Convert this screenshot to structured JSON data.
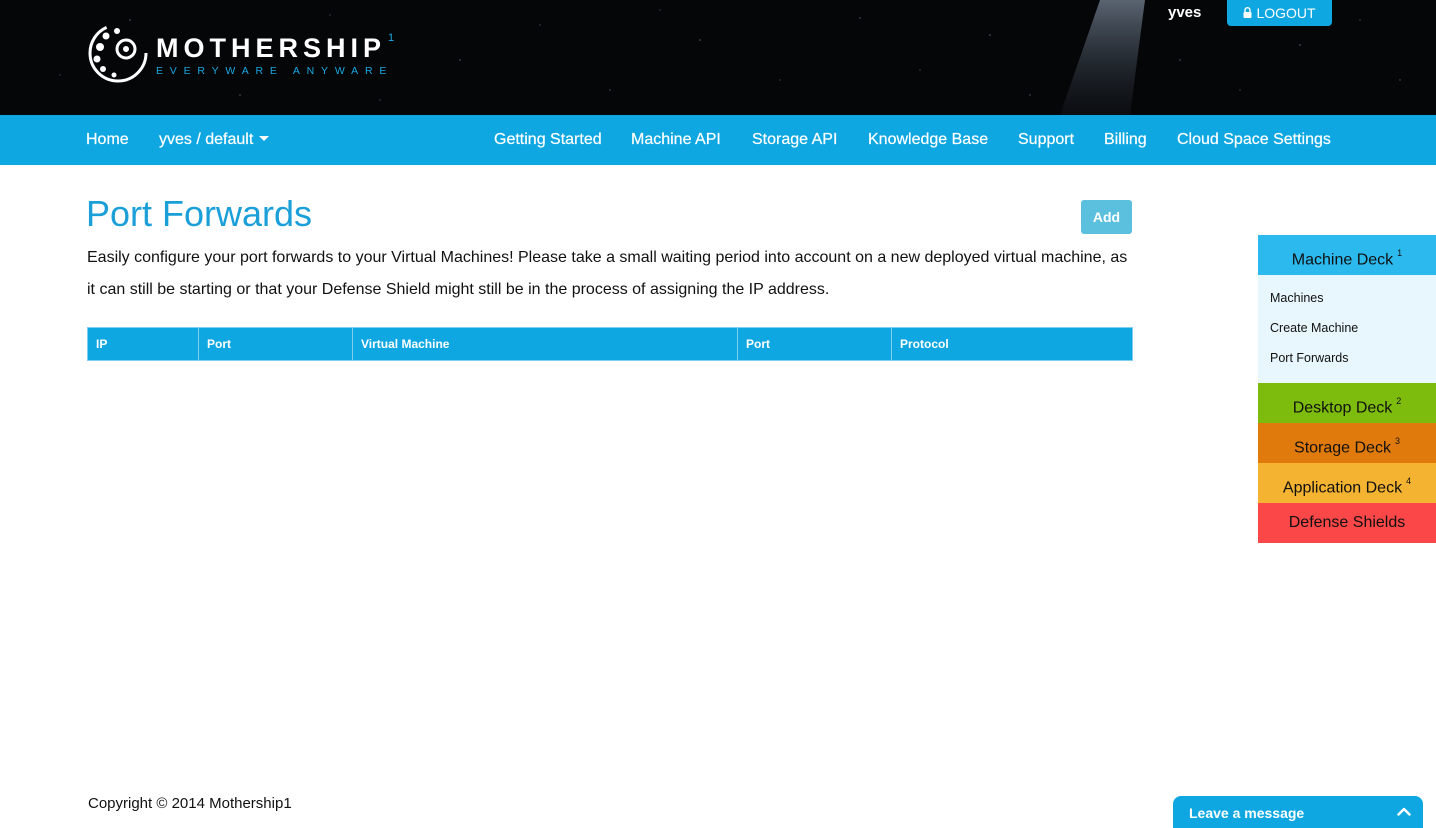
{
  "header": {
    "logo_title": "MOTHERSHIP",
    "logo_sup": "1",
    "logo_tagline": "EVERYWARE ANYWARE",
    "username": "yves",
    "logout_label": "LOGOUT"
  },
  "nav": {
    "home": "Home",
    "cloudspace": "yves / default",
    "getting_started": "Getting Started",
    "machine_api": "Machine API",
    "storage_api": "Storage API",
    "knowledge_base": "Knowledge Base",
    "support": "Support",
    "billing": "Billing",
    "cloud_space_settings": "Cloud Space Settings"
  },
  "main": {
    "title": "Port Forwards",
    "add_label": "Add",
    "intro": "Easily configure your port forwards to your Virtual Machines! Please take a small waiting period into account on a new deployed virtual machine, as it can still be starting or that your Defense Shield might still be in the process of assigning the IP address.",
    "table": {
      "headers": [
        "IP",
        "Port",
        "Virtual Machine",
        "Port",
        "Protocol"
      ],
      "rows": []
    }
  },
  "sidebar": {
    "machine_deck": {
      "label": "Machine Deck",
      "sup": "1"
    },
    "machine_items": [
      "Machines",
      "Create Machine",
      "Port Forwards"
    ],
    "desktop_deck": {
      "label": "Desktop Deck",
      "sup": "2"
    },
    "storage_deck": {
      "label": "Storage Deck",
      "sup": "3"
    },
    "application_deck": {
      "label": "Application Deck",
      "sup": "4"
    },
    "defense_shields": {
      "label": "Defense Shields"
    }
  },
  "footer": {
    "copyright": "Copyright © 2014 Mothership1"
  },
  "chat": {
    "label": "Leave a message"
  },
  "colors": {
    "primary": "#0ea7e2",
    "title": "#1a9fd9",
    "machine_deck": "#2bb9ee",
    "desktop_deck": "#7dbb0c",
    "storage_deck": "#e07a0c",
    "application_deck": "#f4b331",
    "defense_shields": "#fb4747"
  }
}
